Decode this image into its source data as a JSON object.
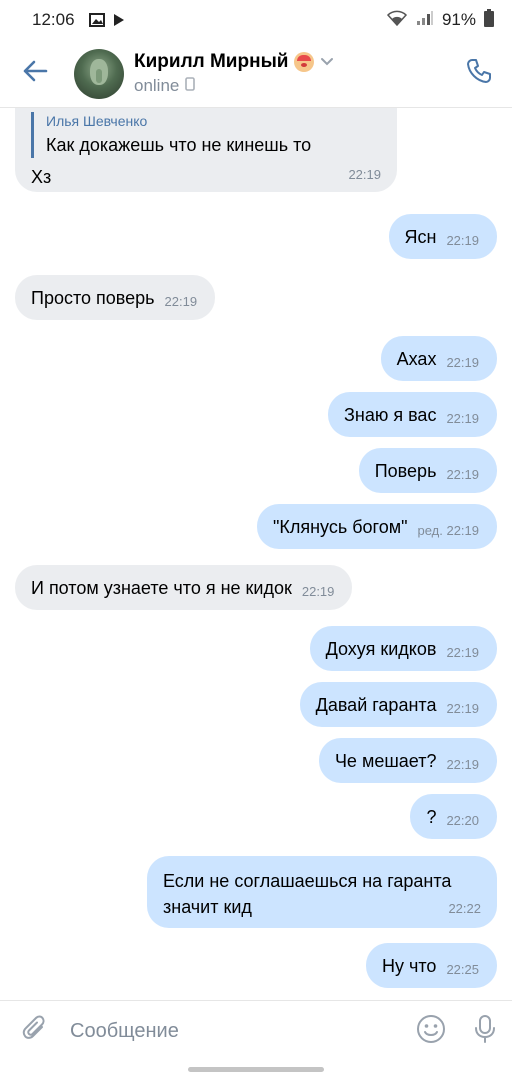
{
  "status_bar": {
    "time": "12:06",
    "battery": "91%"
  },
  "header": {
    "name": "Кирилл Мирный",
    "status": "online"
  },
  "messages": [
    {
      "dir": "in",
      "reply_name": "Илья Шевченко",
      "reply_text": "Как докажешь что не кинешь то",
      "text": "Хз",
      "time": "22:19"
    },
    {
      "dir": "out",
      "text": "Ясн",
      "time": "22:19"
    },
    {
      "dir": "in",
      "text": "Просто поверь",
      "time": "22:19"
    },
    {
      "dir": "out",
      "text": "Ахах",
      "time": "22:19"
    },
    {
      "dir": "out",
      "text": "Знаю я вас",
      "time": "22:19"
    },
    {
      "dir": "out",
      "text": "Поверь",
      "time": "22:19"
    },
    {
      "dir": "out",
      "text": "\"Клянусь богом\"",
      "time": "ред. 22:19"
    },
    {
      "dir": "in",
      "text": "И потом узнаете что я не кидок",
      "time": "22:19"
    },
    {
      "dir": "out",
      "text": "Дохуя кидков",
      "time": "22:19"
    },
    {
      "dir": "out",
      "text": "Давай гаранта",
      "time": "22:19"
    },
    {
      "dir": "out",
      "text": "Че мешает?",
      "time": "22:19"
    },
    {
      "dir": "out",
      "text": "?",
      "time": "22:20"
    },
    {
      "dir": "out",
      "text_line1": "Если не соглашаешься на гаранта",
      "text_line2": "значит кид",
      "time": "22:22"
    },
    {
      "dir": "out",
      "text": "Ну что",
      "time": "22:25"
    }
  ],
  "composer": {
    "placeholder": "Сообщение"
  },
  "colors": {
    "accent": "#4a76a8",
    "bubble_in": "#ebedf0",
    "bubble_out": "#cce4ff",
    "secondary_text": "#818c99"
  }
}
